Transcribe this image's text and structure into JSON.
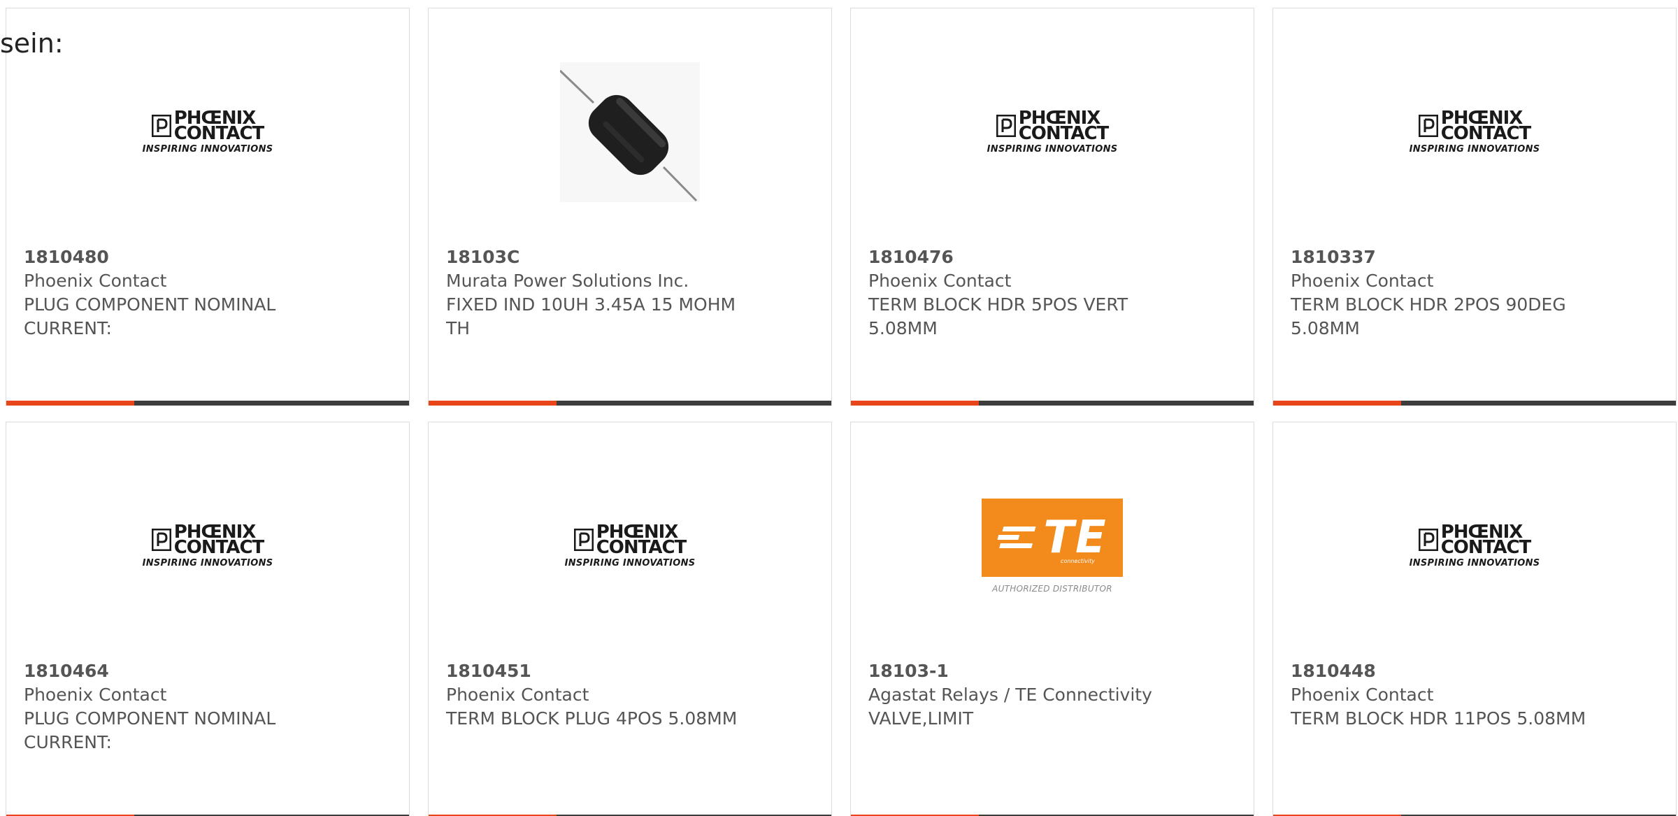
{
  "intro_text": "sein:",
  "brand_colors": {
    "accent": "#e8461a",
    "bar": "#3c3c3c",
    "te_orange": "#f28a1c"
  },
  "logos": {
    "phoenix": {
      "line1": "PHŒNIX",
      "line2": "CONTACT",
      "tagline": "INSPIRING INNOVATIONS"
    },
    "te": {
      "mark": "TE",
      "sub": "connectivity",
      "badge": "AUTHORIZED DISTRIBUTOR"
    }
  },
  "products": [
    {
      "part_number": "1810480",
      "manufacturer": "Phoenix Contact",
      "description": "PLUG COMPONENT NOMINAL CURRENT:",
      "image": "phoenix-contact-logo"
    },
    {
      "part_number": "18103C",
      "manufacturer": "Murata Power Solutions Inc.",
      "description": "FIXED IND 10UH 3.45A 15 MOHM TH",
      "image": "inductor-photo"
    },
    {
      "part_number": "1810476",
      "manufacturer": "Phoenix Contact",
      "description": "TERM BLOCK HDR 5POS VERT 5.08MM",
      "image": "phoenix-contact-logo"
    },
    {
      "part_number": "1810337",
      "manufacturer": "Phoenix Contact",
      "description": "TERM BLOCK HDR 2POS 90DEG 5.08MM",
      "image": "phoenix-contact-logo"
    },
    {
      "part_number": "1810464",
      "manufacturer": "Phoenix Contact",
      "description": "PLUG COMPONENT NOMINAL CURRENT:",
      "image": "phoenix-contact-logo"
    },
    {
      "part_number": "1810451",
      "manufacturer": "Phoenix Contact",
      "description": "TERM BLOCK PLUG 4POS 5.08MM",
      "image": "phoenix-contact-logo"
    },
    {
      "part_number": "18103-1",
      "manufacturer": "Agastat Relays / TE Connectivity",
      "description": "VALVE,LIMIT",
      "image": "te-connectivity-logo"
    },
    {
      "part_number": "1810448",
      "manufacturer": "Phoenix Contact",
      "description": "TERM BLOCK HDR 11POS 5.08MM",
      "image": "phoenix-contact-logo"
    }
  ]
}
